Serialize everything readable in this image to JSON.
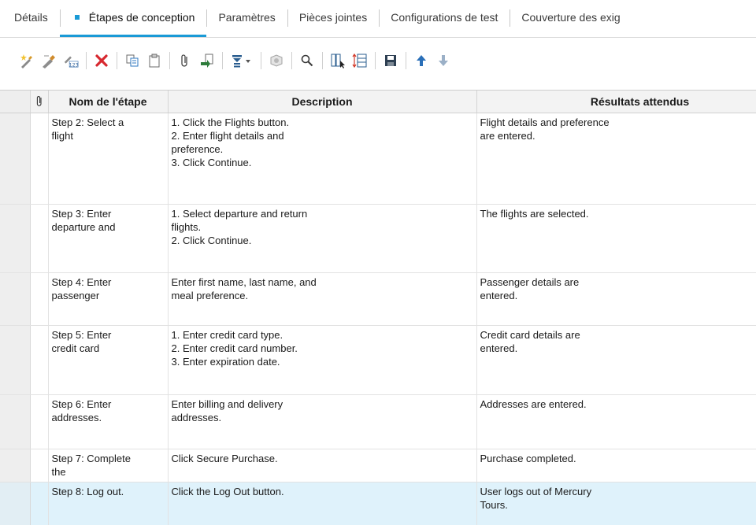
{
  "tabs": [
    {
      "label": "Détails",
      "active": false
    },
    {
      "label": "Étapes de conception",
      "active": true
    },
    {
      "label": "Paramètres",
      "active": false
    },
    {
      "label": "Pièces jointes",
      "active": false
    },
    {
      "label": "Configurations de test",
      "active": false
    },
    {
      "label": "Couverture des exig",
      "active": false
    }
  ],
  "toolbar": {
    "buttons": [
      "new-step-icon",
      "edit-step-icon",
      "renumber-steps-icon",
      "delete-icon",
      "copy-icon",
      "paste-icon",
      "attachment-icon",
      "call-to-test-icon",
      "insert-parameter-icon",
      "generate-script-icon",
      "find-icon",
      "select-columns-icon",
      "set-height-icon",
      "save-icon",
      "move-up-icon",
      "move-down-icon"
    ]
  },
  "grid": {
    "columns": {
      "attachment": "",
      "step_name": "Nom de l'étape",
      "description": "Description",
      "expected": "Résultats attendus"
    },
    "rows": [
      {
        "name": "Step 2: Select a\nflight",
        "description": "1. Click the Flights button.\n2. Enter flight details and\npreference.\n3. Click Continue.",
        "expected": "Flight details and preference\nare entered."
      },
      {
        "name": "Step 3: Enter\ndeparture and",
        "description": "1. Select departure and return\nflights.\n2. Click Continue.",
        "expected": "The flights are selected."
      },
      {
        "name": "Step 4: Enter\npassenger",
        "description": "Enter first name, last name, and\nmeal preference.",
        "expected": "Passenger details are\nentered."
      },
      {
        "name": "Step 5: Enter\ncredit card",
        "description": "1. Enter credit card type.\n2. Enter credit card number.\n3. Enter expiration date.",
        "expected": "Credit card details are\nentered."
      },
      {
        "name": "Step 6: Enter\naddresses.",
        "description": "Enter billing and delivery\naddresses.",
        "expected": "Addresses are entered."
      },
      {
        "name": "Step 7: Complete\nthe",
        "description": "Click Secure Purchase.",
        "expected": "Purchase completed."
      },
      {
        "name": "Step 8: Log out.",
        "description": "Click the Log Out button.",
        "expected": "User logs out of Mercury\nTours."
      }
    ]
  },
  "colors": {
    "accent": "#1a9ad6",
    "selected_row": "#dff2fb",
    "delete_red": "#d7282f",
    "header_bg": "#f3f3f3"
  }
}
